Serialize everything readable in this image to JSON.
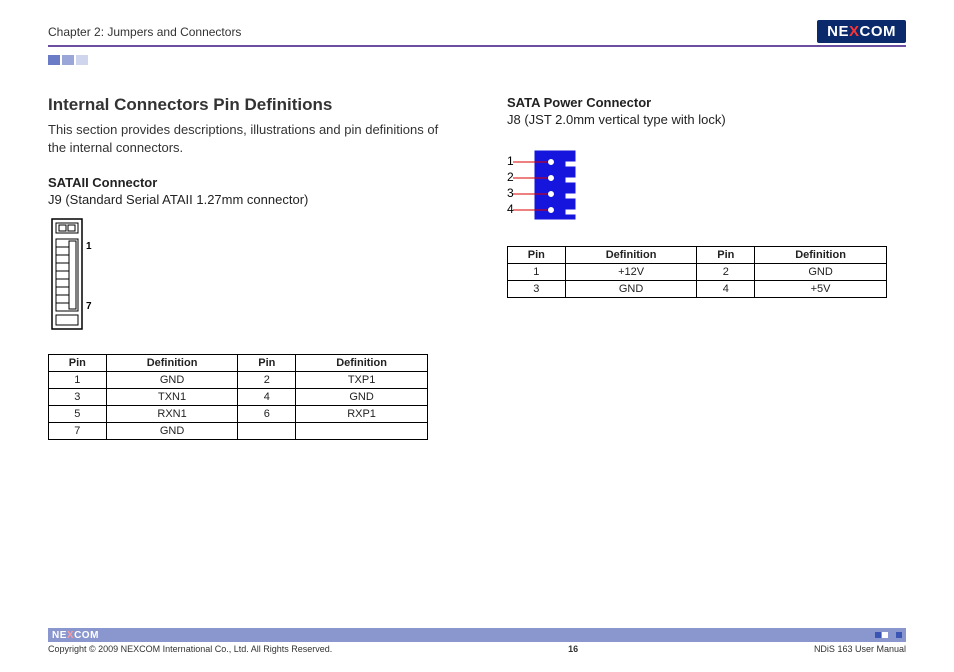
{
  "header": {
    "chapter": "Chapter 2: Jumpers and Connectors",
    "logo_pre": "NE",
    "logo_x": "X",
    "logo_post": "COM"
  },
  "left": {
    "title": "Internal Connectors Pin Definitions",
    "desc": "This section provides descriptions, illustrations and pin definitions of the internal connectors.",
    "sub_title": "SATAII Connector",
    "sub_desc": "J9 (Standard Serial ATAII 1.27mm connector)",
    "label1": "1",
    "label7": "7",
    "table": {
      "h_pin": "Pin",
      "h_def": "Definition",
      "r": [
        {
          "p1": "1",
          "d1": "GND",
          "p2": "2",
          "d2": "TXP1"
        },
        {
          "p1": "3",
          "d1": "TXN1",
          "p2": "4",
          "d2": "GND"
        },
        {
          "p1": "5",
          "d1": "RXN1",
          "p2": "6",
          "d2": "RXP1"
        },
        {
          "p1": "7",
          "d1": "GND",
          "p2": "",
          "d2": ""
        }
      ]
    }
  },
  "right": {
    "sub_title": "SATA Power Connector",
    "sub_desc": "J8 (JST 2.0mm vertical type with lock)",
    "pin_labels": {
      "1": "1",
      "2": "2",
      "3": "3",
      "4": "4"
    },
    "table": {
      "h_pin": "Pin",
      "h_def": "Definition",
      "r": [
        {
          "p1": "1",
          "d1": "+12V",
          "p2": "2",
          "d2": "GND"
        },
        {
          "p1": "3",
          "d1": "GND",
          "p2": "4",
          "d2": "+5V"
        }
      ]
    }
  },
  "footer": {
    "logo_pre": "NE",
    "logo_x": "X",
    "logo_post": "COM",
    "copyright": "Copyright © 2009 NEXCOM International Co., Ltd. All Rights Reserved.",
    "page": "16",
    "manual": "NDiS 163 User Manual"
  }
}
